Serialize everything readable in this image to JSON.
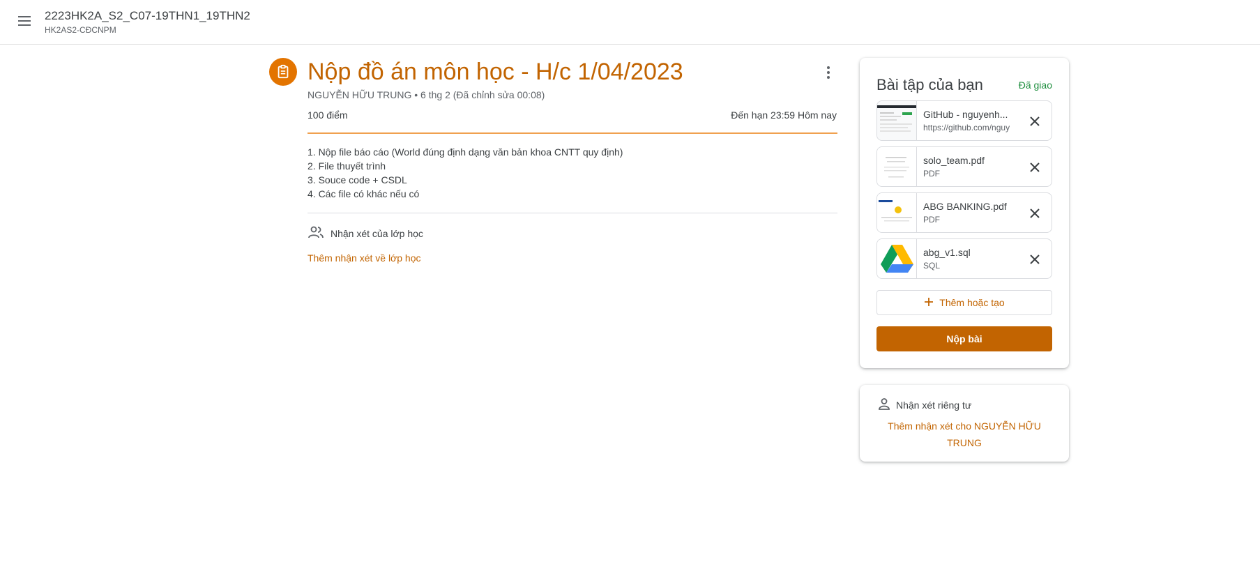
{
  "colors": {
    "accent": "#c26401",
    "accent_light": "#e37400",
    "status_green": "#1e8e3e",
    "text": "#3c4043",
    "subtext": "#5f6368"
  },
  "header": {
    "class_name": "2223HK2A_S2_C07-19THN1_19THN2",
    "class_section": "HK2AS2-CĐCNPM",
    "menu_icon": "hamburger-menu-icon"
  },
  "assignment": {
    "icon": "assignment-icon",
    "title": "Nộp đồ án môn học - H/c 1/04/2023",
    "meta": "NGUYỄN HỮU TRUNG • 6 thg 2 (Đã chỉnh sửa 00:08)",
    "points": "100 điểm",
    "due": "Đến hạn 23:59 Hôm nay",
    "instructions": [
      "1. Nộp file báo cáo (World đúng định dạng văn bản khoa CNTT quy định)",
      "2. File thuyết trình",
      "3. Souce code + CSDL",
      "4. Các file có khác nếu có"
    ],
    "class_comments_label": "Nhận xét của lớp học",
    "add_class_comment": "Thêm nhận xét về lớp học"
  },
  "your_work": {
    "title": "Bài tập của bạn",
    "status": "Đã giao",
    "attachments": [
      {
        "name": "GitHub - nguyenh...",
        "type": "https://github.com/nguy",
        "thumb": "github-thumbnail"
      },
      {
        "name": "solo_team.pdf",
        "type": "PDF",
        "thumb": "pdf-thumbnail"
      },
      {
        "name": "ABG BANKING.pdf",
        "type": "PDF",
        "thumb": "pdf-thumbnail"
      },
      {
        "name": "abg_v1.sql",
        "type": "SQL",
        "thumb": "google-drive-icon"
      }
    ],
    "add_or_create": "Thêm hoặc tạo",
    "submit": "Nộp bài"
  },
  "private_comments": {
    "label": "Nhận xét riêng tư",
    "add": "Thêm nhận xét cho NGUYỄN HỮU TRUNG"
  }
}
